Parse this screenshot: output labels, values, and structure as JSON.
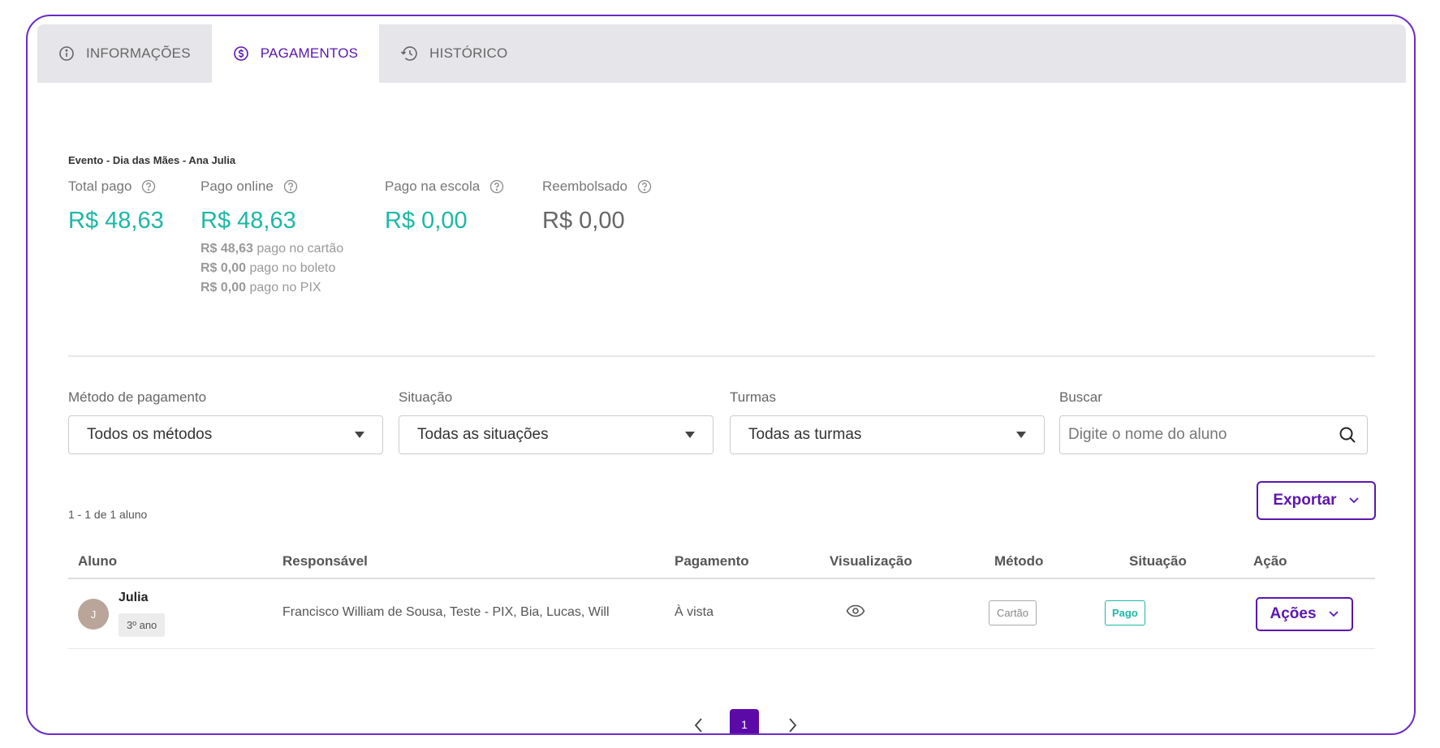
{
  "tabs": [
    {
      "label": "INFORMAÇÕES",
      "icon": "info-icon"
    },
    {
      "label": "PAGAMENTOS",
      "icon": "dollar-circle-icon",
      "active": true
    },
    {
      "label": "HISTÓRICO",
      "icon": "history-icon"
    }
  ],
  "event": {
    "title": "Evento - Dia das Mães - Ana Julia"
  },
  "stats": {
    "total": {
      "label": "Total pago",
      "value": "R$ 48,63"
    },
    "online": {
      "label": "Pago online",
      "value": "R$ 48,63",
      "details": [
        {
          "amount": "R$ 48,63",
          "text": "pago no cartão"
        },
        {
          "amount": "R$ 0,00",
          "text": "pago no boleto"
        },
        {
          "amount": "R$ 0,00",
          "text": "pago no PIX"
        }
      ]
    },
    "school": {
      "label": "Pago na escola",
      "value": "R$ 0,00"
    },
    "refunded": {
      "label": "Reembolsado",
      "value": "R$ 0,00"
    }
  },
  "filters": {
    "method": {
      "label": "Método de pagamento",
      "value": "Todos os métodos"
    },
    "status": {
      "label": "Situação",
      "value": "Todas as situações"
    },
    "classes": {
      "label": "Turmas",
      "value": "Todas as turmas"
    },
    "search": {
      "label": "Buscar",
      "placeholder": "Digite o nome do aluno"
    }
  },
  "results": {
    "count_text": "1 - 1 de 1 aluno",
    "export_label": "Exportar"
  },
  "table": {
    "headers": {
      "student": "Aluno",
      "responsible": "Responsável",
      "payment": "Pagamento",
      "view": "Visualização",
      "method": "Método",
      "status": "Situação",
      "action": "Ação"
    },
    "rows": [
      {
        "initial": "J",
        "name": "Julia",
        "grade": "3º ano",
        "responsible": "Francisco William de Sousa, Teste - PIX, Bia, Lucas, Will",
        "payment": "À vista",
        "method": "Cartão",
        "status": "Pago",
        "action_label": "Ações"
      }
    ]
  },
  "pagination": {
    "current": "1"
  },
  "colors": {
    "primary": "#5b16b0",
    "green": "#1cb8a5",
    "border": "#6a2cc4"
  }
}
